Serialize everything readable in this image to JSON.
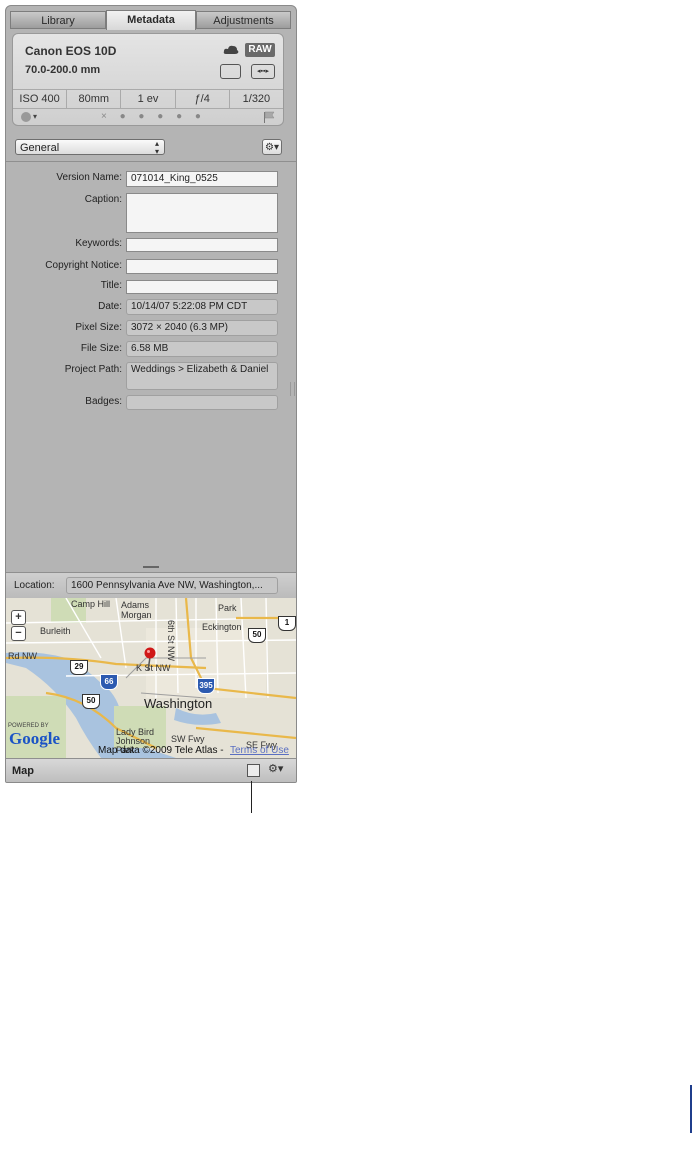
{
  "tabs": [
    "Library",
    "Metadata",
    "Adjustments"
  ],
  "camera": {
    "model": "Canon EOS 10D",
    "lens": "70.0-200.0 mm",
    "raw_badge": "RAW",
    "exif": [
      "ISO 400",
      "80mm",
      "1 ev",
      "ƒ/4",
      "1/320"
    ],
    "rating": "× ● ● ● ● ●"
  },
  "view_dropdown": "General",
  "fields": [
    {
      "label": "Version Name:",
      "value": "071014_King_0525"
    },
    {
      "label": "Caption:",
      "value": ""
    },
    {
      "label": "Keywords:",
      "value": ""
    },
    {
      "label": "Copyright Notice:",
      "value": ""
    },
    {
      "label": "Title:",
      "value": ""
    },
    {
      "label": "Date:",
      "value": "10/14/07 5:22:08 PM CDT"
    },
    {
      "label": "Pixel Size:",
      "value": "3072 × 2040 (6.3 MP)"
    },
    {
      "label": "File Size:",
      "value": "6.58 MB"
    },
    {
      "label": "Project Path:",
      "value": "Weddings > Elizabeth & Daniel"
    },
    {
      "label": "Badges:",
      "value": ""
    }
  ],
  "location": {
    "label": "Location:",
    "value": "1600 Pennsylvania Ave NW, Washington,..."
  },
  "map": {
    "places": [
      "Camp Hill",
      "Adams Morgan",
      "Burleith",
      "Eckington",
      "Park",
      "K St NW",
      "Washington",
      "Lady Bird Johnson Park",
      "SW Fwy",
      "SE Fwy",
      "6th St NW",
      "Rd NW"
    ],
    "routes": [
      "50",
      "29",
      "66",
      "50",
      "395",
      "1"
    ],
    "attribution": "Map data ©2009 Tele Atlas -",
    "terms_link": "Terms of Use",
    "powered_by": "POWERED BY",
    "google": "Google"
  },
  "bottom_bar": {
    "title": "Map"
  }
}
